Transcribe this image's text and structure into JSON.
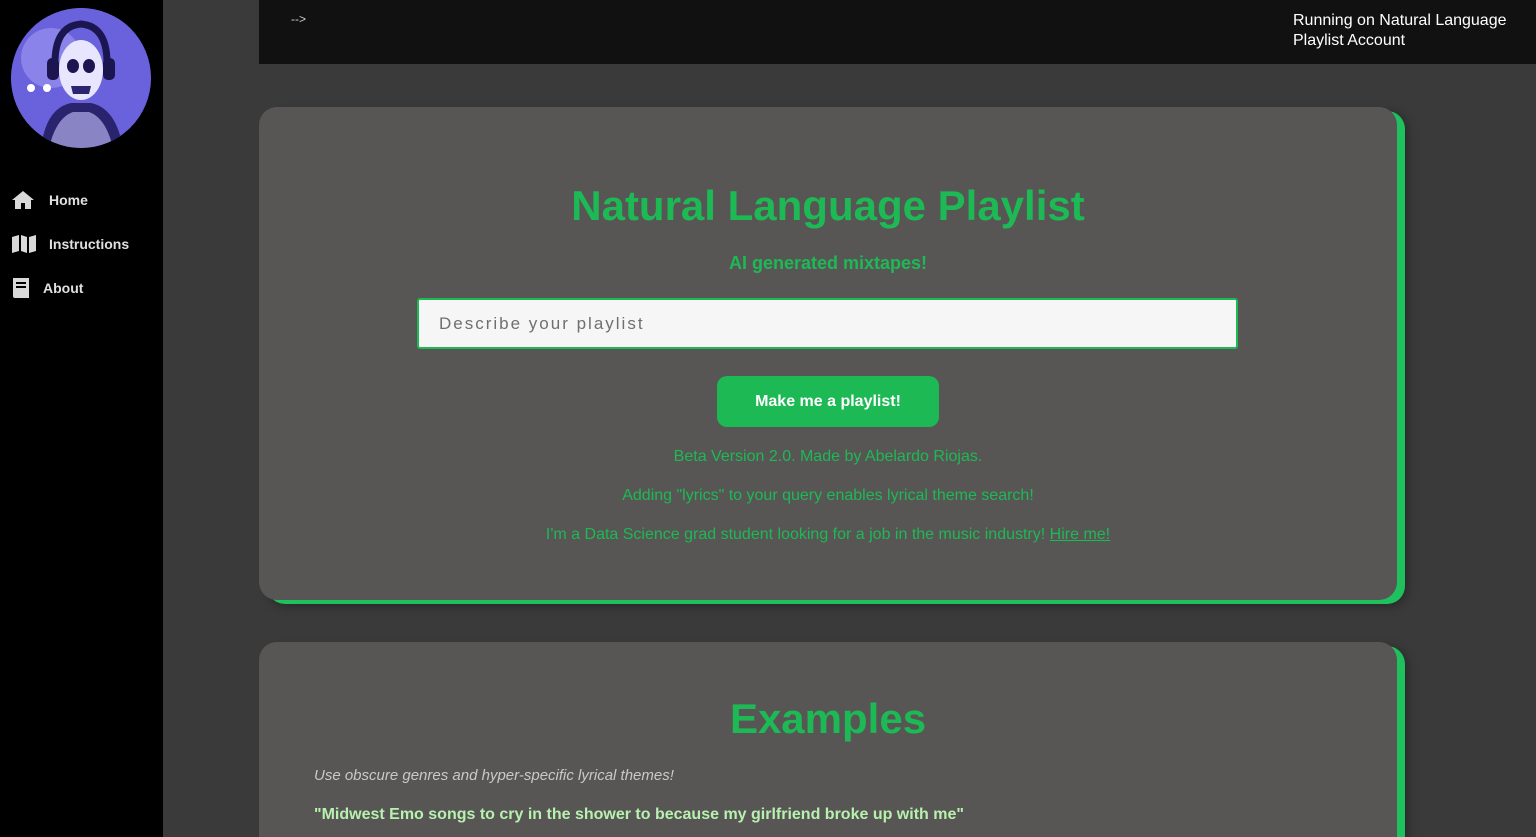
{
  "sidebar": {
    "items": [
      {
        "label": "Home",
        "icon": "home-icon"
      },
      {
        "label": "Instructions",
        "icon": "map-icon"
      },
      {
        "label": "About",
        "icon": "book-icon"
      }
    ]
  },
  "topbar": {
    "arrow_text": "-->",
    "status": "Running on Natural Language Playlist Account"
  },
  "hero": {
    "title": "Natural Language Playlist",
    "subtitle": "AI generated mixtapes!",
    "input_placeholder": "Describe your playlist",
    "input_value": "",
    "button_label": "Make me a playlist!",
    "version_line": "Beta Version 2.0. Made by Abelardo Riojas.",
    "lyrics_line": "Adding \"lyrics\" to your query enables lyrical theme search!",
    "job_line": "I'm a Data Science grad student looking for a job in the music industry! ",
    "hire_link": "Hire me!"
  },
  "examples": {
    "title": "Examples",
    "hint": "Use obscure genres and hyper-specific lyrical themes!",
    "items": [
      "\"Midwest Emo songs to cry in the shower to because my girlfriend broke up with me\""
    ]
  },
  "colors": {
    "accent": "#1db954",
    "sidebar_bg": "#000000",
    "page_bg": "#3a3a3a",
    "card_bg": "#575654"
  }
}
